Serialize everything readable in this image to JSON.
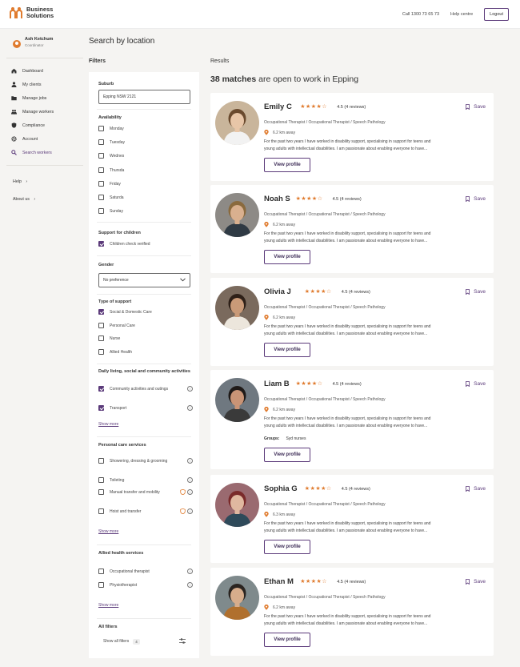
{
  "brand": {
    "line1": "Business",
    "line2": "Solutions",
    "accent": "#e07b2e",
    "primary": "#5b3a7a"
  },
  "header": {
    "call": "Call 1300 73 65 73",
    "help": "Help centre",
    "logout": "Logout"
  },
  "user": {
    "name": "Ash Ketchum",
    "role": "Coordinator"
  },
  "nav": [
    {
      "label": "Dashboard",
      "icon": "home-icon"
    },
    {
      "label": "My clients",
      "icon": "person-icon"
    },
    {
      "label": "Manage jobs",
      "icon": "folder-icon"
    },
    {
      "label": "Manage workers",
      "icon": "people-icon"
    },
    {
      "label": "Compliance",
      "icon": "shield-icon"
    },
    {
      "label": "Account",
      "icon": "gear-icon"
    },
    {
      "label": "Search workers",
      "icon": "search-icon"
    }
  ],
  "help_links": [
    {
      "label": "Help"
    },
    {
      "label": "About us"
    }
  ],
  "page": {
    "title": "Search by location",
    "filters_heading": "Filters",
    "results_heading": "Results",
    "matches_count": "38 matches",
    "matches_suffix": " are open to work in Epping"
  },
  "filters": {
    "suburb_label": "Suburb",
    "suburb_value": "Epping NSW 2121",
    "availability_label": "Availability",
    "days": [
      "Monday",
      "Tuesday",
      "Wednes",
      "Thursda",
      "Friday",
      "Saturda",
      "Sunday"
    ],
    "children_label": "Support for children",
    "children_option": "Children check verified",
    "gender_label": "Gender",
    "gender_value": "No preference",
    "support_type_label": "Type of support",
    "support_types": [
      {
        "label": "Social & Domestic Care",
        "checked": true
      },
      {
        "label": "Personal Care",
        "checked": false
      },
      {
        "label": "Nurse",
        "checked": false
      },
      {
        "label": "Allied Health",
        "checked": false
      }
    ],
    "daily_living_label": "Daily living, social and community activities",
    "daily_living": [
      {
        "label": "Community activities and outings",
        "checked": true
      },
      {
        "label": "Transport",
        "checked": true
      }
    ],
    "show_more": "Show more",
    "personal_care_label": "Personal care services",
    "personal_care": [
      {
        "label": "Showering, dressing & grooming"
      },
      {
        "label": "Toileting"
      },
      {
        "label": "Manual transfer and mobility"
      },
      {
        "label": "Hoist and transfer"
      }
    ],
    "allied_label": "Allied health services",
    "allied": [
      {
        "label": "Occupational therapist"
      },
      {
        "label": "Physiotherapist"
      }
    ],
    "all_filters_label": "All filters",
    "show_all_label": "Show all filters",
    "show_all_count": "4"
  },
  "common": {
    "role": "Occupational Therapist / Occupational Therapist / Speech Pathology",
    "bio_line1": "For the past two years I have worked in disability support, specialising in support for teens and",
    "bio_line2": "young adults with intellectual disabilities. I am passionate about enabling everyone to have...",
    "save": "Save",
    "view_profile": "View profile",
    "stars": "★★★★☆"
  },
  "workers": [
    {
      "name": "Emily C",
      "rating": "4.5 (4 reviews)",
      "distance": "6.2 km away"
    },
    {
      "name": "Noah S",
      "rating": "4.5 (4 reviews)",
      "distance": "6.2 km away"
    },
    {
      "name": "Olivia J",
      "rating": "4.5 (4 reviews)",
      "distance": "6.2 km away"
    },
    {
      "name": "Liam B",
      "rating": "4.5 (4 reviews)",
      "distance": "6.2 km away",
      "groups_label": "Groups:",
      "groups_value": "Syd nurses"
    },
    {
      "name": "Sophia G",
      "rating": "4.5 (4 reviews)",
      "distance": "6.3 km away"
    },
    {
      "name": "Ethan M",
      "rating": "4.5 (4 reviews)",
      "distance": "6.2 km away"
    }
  ]
}
